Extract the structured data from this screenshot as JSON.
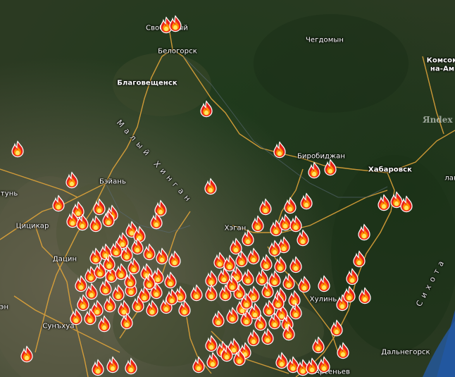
{
  "watermark": "Яndex",
  "labels": {
    "svobodny": "Свободный",
    "belogorsk": "Белогорск",
    "blagoveshchensk": "Благовещенск",
    "chegdomyn": "Чегдомын",
    "komsomolsk_line1": "Комсом",
    "komsomolsk_line2": "на-Ам",
    "birobidzhan": "Биробиджан",
    "khabarovsk": "Хабаровск",
    "beyan": "Бэйань",
    "tsitsikar": "Цицикар",
    "datsin": "Дацин",
    "khegan": "Хэган",
    "khulin": "Хулинь",
    "sunhua": "Сунъхуа",
    "arseniev": "Арсеньев",
    "dalnegorsk": "Дальнегорск",
    "lan": "лань",
    "edge_tyn": "ятунь",
    "edge_en": "эн",
    "maly_khingan": "Малый Хинган",
    "sikhote": "Сихота"
  },
  "fire_icon": "flame-icon",
  "colors": {
    "fire_outer": "#e8231a",
    "fire_mid": "#ff8c00",
    "fire_inner": "#ffe45c",
    "road": "#e0a43a",
    "water": "#1d4c8f"
  }
}
